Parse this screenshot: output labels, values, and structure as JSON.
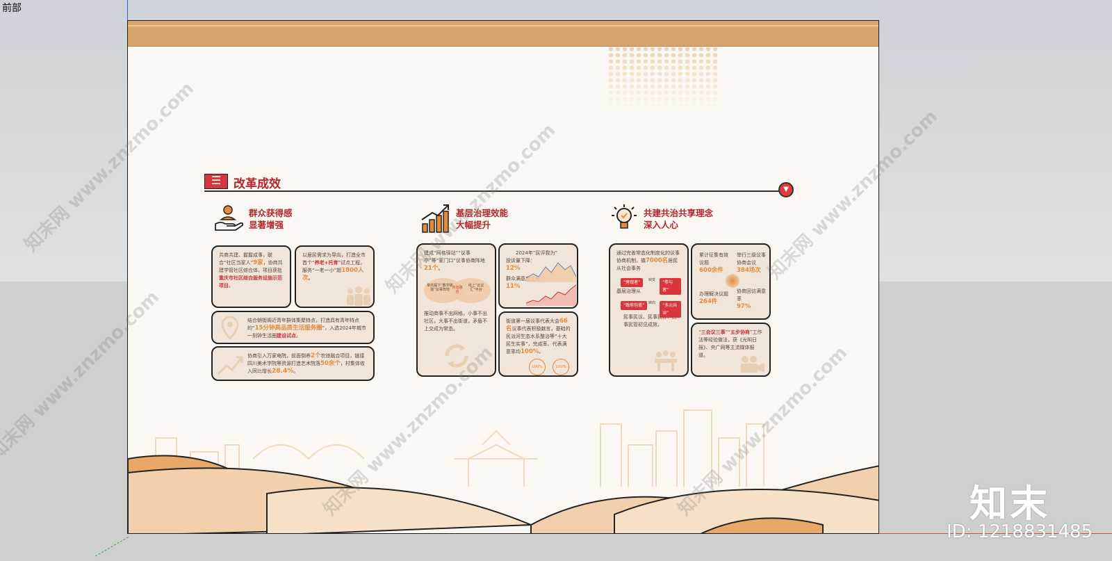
{
  "viewport": {
    "view_label": "前部"
  },
  "watermark": {
    "text": "知末网 www.znzmo.com",
    "logo": "知末",
    "id_label": "ID: 1218831485"
  },
  "section": {
    "title": "改革成效"
  },
  "columns": [
    {
      "title_line1": "群众获得感",
      "title_line2": "显著增强",
      "icon": "hand-person-icon"
    },
    {
      "title_line1": "基层治理效能",
      "title_line2": "大幅提升",
      "icon": "bar-chart-growth-icon"
    },
    {
      "title_line1": "共建共治共享理念",
      "title_line2": "深入人心",
      "icon": "lightbulb-icon"
    }
  ],
  "cards": {
    "c1a": {
      "pre": "共商共建、握握成事，联合“社区当家人”",
      "num": "9家",
      "mid": "，协商共建学管社区综合体，项目获批",
      "red": "重庆市社区综合服务设施示范项目",
      "post": "。"
    },
    "c1b": {
      "pre": "以居民需求为导向，打造全市首个“",
      "red": "养老+托育",
      "mid": "”试点工程，服务“一老一小”超",
      "num": "1800人次",
      "post": "。"
    },
    "c1c": {
      "pre": "结合朝街阁近青年群体集聚特点，打造具有青年特点的“",
      "hl": "15分钟高品质生活服务圈",
      "mid": "”，入选2024年城市一刻钟生活圈",
      "red": "建设试点",
      "post": "。"
    },
    "c1d": {
      "pre": "协商引入万家电院，前面倒养",
      "num1": "2个",
      "mid": "农旅融合项目，链接四川美术学院等资源打造艺术院落",
      "num2": "50余个",
      "mid2": "，村集体收入同比增长",
      "num3": "28.4%",
      "post": "。"
    },
    "c2a": {
      "pre": "建成“网格驿站”“议事亭”等“家门口”议事协商阵地",
      "num": "21个",
      "post": "。",
      "venn_left": "单托提下“数字赋能”议事阵地",
      "venn_mid": "共治融合",
      "venn_right": "线上“云议汇”平台",
      "bottom": "推动商事不出网格，小事不出社区，大事不出街道，矛盾不上交成为常态。"
    },
    "c2b": {
      "title": "2024年“民评我为”",
      "line1": "投诉量下降：",
      "num1": "12%",
      "line2": "群众满意度上升：",
      "num2": "11%"
    },
    "c2c": {
      "pre": "街道第一届议事代表大会",
      "num1": "66名",
      "mid": "议事代表积极献言，基础的民派河生态水系整治等“十大民生实事”，完成率、代表满意率均",
      "num2": "100%",
      "post": "。",
      "badge1": "100%",
      "badge2": "100%"
    },
    "c3a": {
      "pre": "通过完善常态化制度化的议事协商机制，撬",
      "num": "7000名",
      "post": "居民从社会事务",
      "pill1": "“旁观者”",
      "arrow1": "转变",
      "pill2": "“参与者”",
      "line2": "基层治理从",
      "pill3": "“政府包揽”",
      "arrow2": "转向",
      "pill4": "“多元共治”",
      "bottom": "民事民议、民事民办、民事民管初见成效。"
    },
    "c3b": {
      "l1": "累计征集有效议题",
      "n1": "600余件",
      "l2": "举行三级议事协商会议",
      "n2": "384场次",
      "l3": "办理解决议题",
      "n3": "264件",
      "l4": "协商回访满意率",
      "n4": "97%"
    },
    "c3c": {
      "pre": "“",
      "hl": "三会议三事",
      "mid": "”“",
      "hl2": "五步协商",
      "post": "”工作法等经验做法，获《光明日报》、央广网等主流媒体报道。"
    }
  },
  "colors": {
    "accent_orange": "#e48a3b",
    "brand_red": "#c9343a",
    "band": "#d8a66c",
    "card_bg": "#f1e5da"
  }
}
